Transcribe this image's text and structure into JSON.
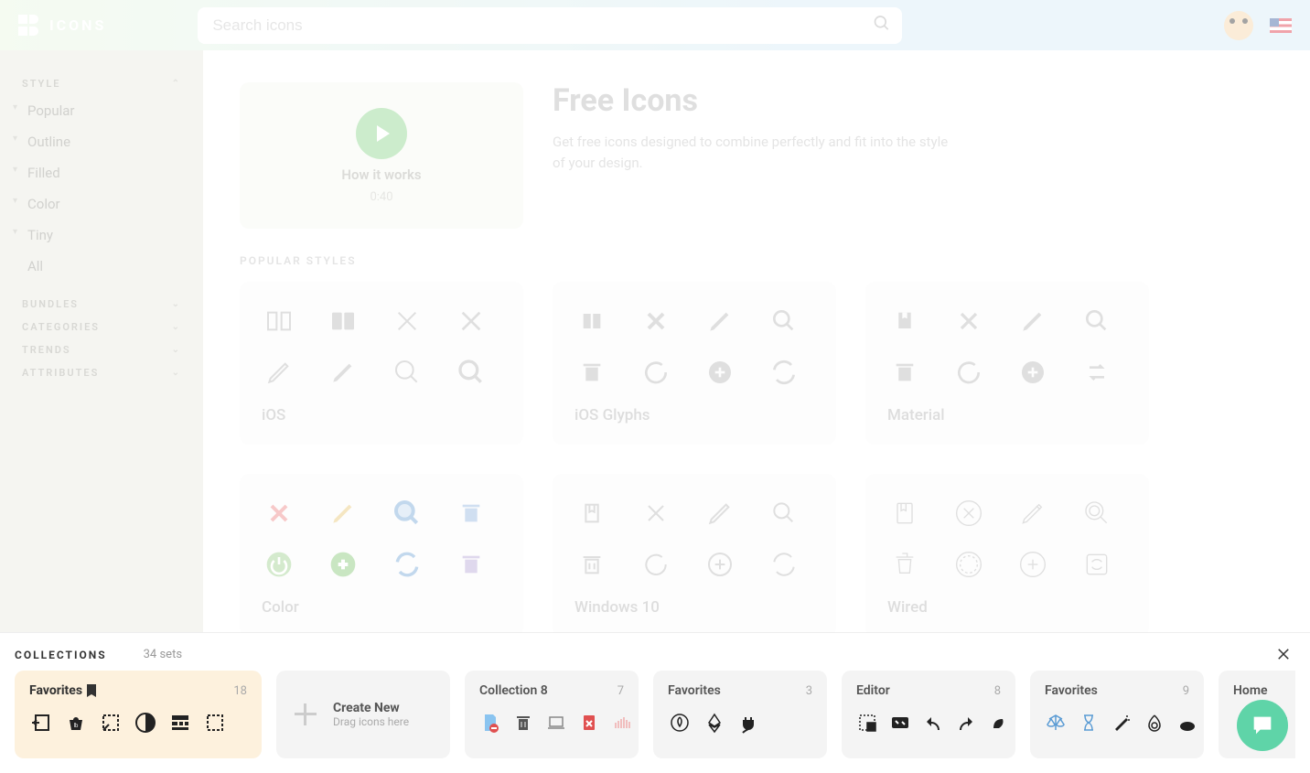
{
  "header": {
    "brand": "ICONS",
    "search_placeholder": "Search icons"
  },
  "sidebar": {
    "sections": [
      {
        "title": "STYLE",
        "expanded": true,
        "items": [
          "Popular",
          "Outline",
          "Filled",
          "Color",
          "Tiny",
          "All"
        ]
      },
      {
        "title": "BUNDLES",
        "expanded": false
      },
      {
        "title": "CATEGORIES",
        "expanded": false
      },
      {
        "title": "TRENDS",
        "expanded": false
      },
      {
        "title": "ATTRIBUTES",
        "expanded": false
      }
    ]
  },
  "hero": {
    "video_title": "How it works",
    "video_duration": "0:40",
    "title": "Free Icons",
    "subtitle": "Get free icons designed to combine perfectly and fit into the style of your design."
  },
  "popular_styles_label": "POPULAR STYLES",
  "styles": [
    {
      "name": "iOS"
    },
    {
      "name": "iOS Glyphs"
    },
    {
      "name": "Material"
    },
    {
      "name": "Color"
    },
    {
      "name": "Windows 10"
    },
    {
      "name": "Wired"
    }
  ],
  "collections": {
    "title": "COLLECTIONS",
    "sets_count": "34 sets",
    "create_new": "Create New",
    "create_hint": "Drag icons here",
    "cards": [
      {
        "name": "Favorites",
        "count": "18",
        "active": true,
        "bookmarked": true
      },
      {
        "name": "Collection 8",
        "count": "7"
      },
      {
        "name": "Favorites",
        "count": "3"
      },
      {
        "name": "Editor",
        "count": "8"
      },
      {
        "name": "Favorites",
        "count": "9"
      },
      {
        "name": "Home",
        "count": ""
      }
    ]
  }
}
